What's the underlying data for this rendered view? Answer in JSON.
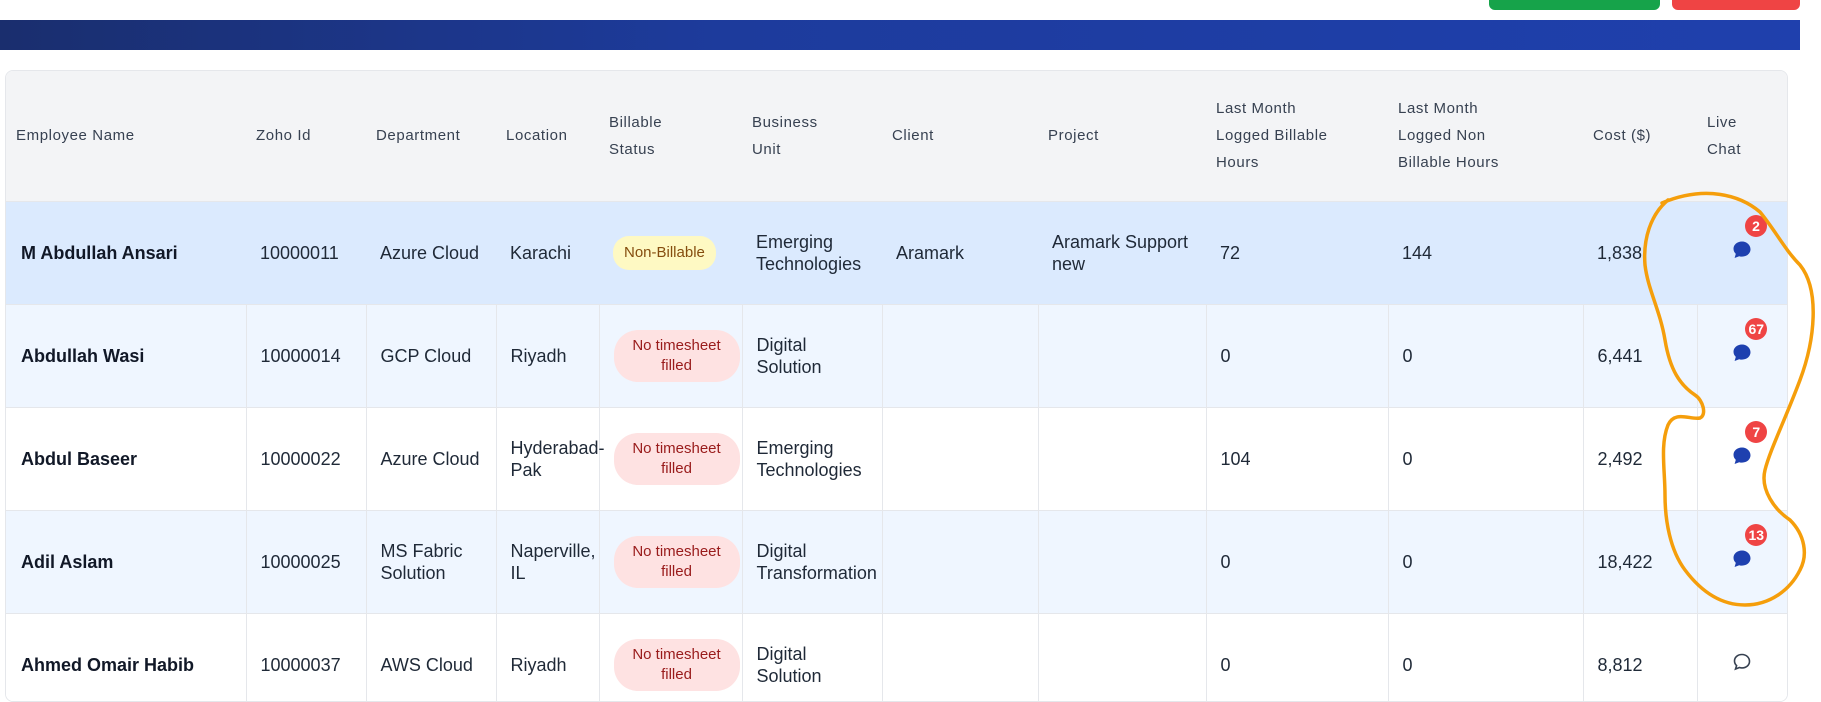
{
  "colors": {
    "banner": "#1f40ad",
    "selected_row": "#dbeafe",
    "alt_row": "#eff6ff",
    "chat_icon": "#1e40af",
    "count_badge": "#ef4444",
    "annotation": "#f59e0b"
  },
  "table": {
    "headers": {
      "employee_name": "Employee Name",
      "zoho_id": "Zoho Id",
      "department": "Department",
      "location": "Location",
      "billable_status": "Billable Status",
      "business_unit": "Business Unit",
      "client": "Client",
      "project": "Project",
      "billable_hours": "Last Month Logged Billable Hours",
      "non_billable_hours": "Last Month Logged Non Billable Hours",
      "cost": "Cost ($)",
      "live_chat": "Live Chat"
    },
    "rows": [
      {
        "name": "M Abdullah Ansari",
        "zoho_id": "10000011",
        "department": "Azure Cloud",
        "location": "Karachi",
        "status": "Non-Billable",
        "business_unit": "Emerging Technologies",
        "client": "Aramark",
        "project": "Aramark Support new",
        "billable_hours": "72",
        "non_billable_hours": "144",
        "cost": "1,838",
        "chat_count": "2",
        "chat_icon": "chat-filled-icon"
      },
      {
        "name": "Abdullah Wasi",
        "zoho_id": "10000014",
        "department": "GCP Cloud",
        "location": "Riyadh",
        "status": "No timesheet filled",
        "business_unit": "Digital Solution",
        "client": "",
        "project": "",
        "billable_hours": "0",
        "non_billable_hours": "0",
        "cost": "6,441",
        "chat_count": "67",
        "chat_icon": "chat-filled-icon"
      },
      {
        "name": "Abdul Baseer",
        "zoho_id": "10000022",
        "department": "Azure Cloud",
        "location": "Hyderabad-Pak",
        "status": "No timesheet filled",
        "business_unit": "Emerging Technologies",
        "client": "",
        "project": "",
        "billable_hours": "104",
        "non_billable_hours": "0",
        "cost": "2,492",
        "chat_count": "7",
        "chat_icon": "chat-filled-icon"
      },
      {
        "name": "Adil Aslam",
        "zoho_id": "10000025",
        "department": "MS Fabric Solution",
        "location": "Naperville, IL",
        "status": "No timesheet filled",
        "business_unit": "Digital Transformation",
        "client": "",
        "project": "",
        "billable_hours": "0",
        "non_billable_hours": "0",
        "cost": "18,422",
        "chat_count": "13",
        "chat_icon": "chat-filled-icon"
      },
      {
        "name": "Ahmed Omair Habib",
        "zoho_id": "10000037",
        "department": "AWS Cloud",
        "location": "Riyadh",
        "status": "No timesheet filled",
        "business_unit": "Digital Solution",
        "client": "",
        "project": "",
        "billable_hours": "0",
        "non_billable_hours": "0",
        "cost": "8,812",
        "chat_count": "",
        "chat_icon": "chat-outline-icon"
      }
    ]
  }
}
